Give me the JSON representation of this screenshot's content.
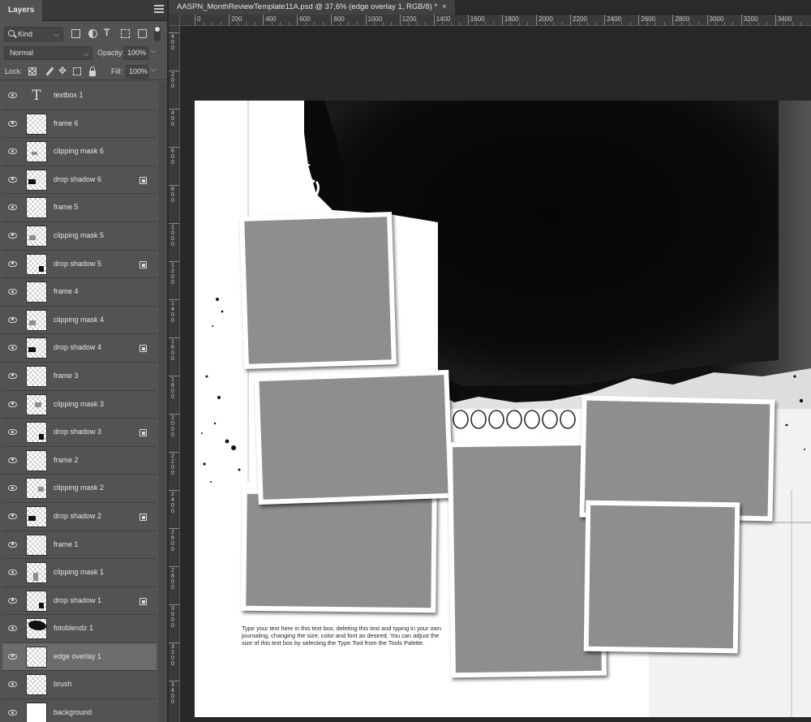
{
  "panel": {
    "title": "Layers",
    "filter_kind": "Kind",
    "blend_mode": "Normal",
    "opacity_label": "Opacity:",
    "opacity_value": "100%",
    "lock_label": "Lock:",
    "fill_label": "Fill:",
    "fill_value": "100%"
  },
  "document": {
    "tab_title": "AASPN_MonthReviewTemplate11A.psd @ 37,6% (edge overlay 1, RGB/8) *",
    "close_glyph": "×"
  },
  "ruler": {
    "h_labels": [
      "0",
      "200",
      "400",
      "600",
      "800",
      "1000",
      "1200",
      "1400",
      "1600",
      "1800",
      "2000",
      "2200",
      "2400",
      "2600",
      "2800",
      "3000",
      "3200",
      "3400"
    ],
    "v_labels": [
      "4\n0\n0",
      "2\n0\n0",
      "4\n0\n0",
      "6\n0\n0",
      "8\n0\n0",
      "1\n0\n0\n0",
      "1\n2\n0\n0",
      "1\n4\n0\n0",
      "1\n6\n0\n0",
      "1\n8\n0\n0",
      "2\n0\n0\n0",
      "2\n2\n0\n0",
      "2\n4\n0\n0",
      "2\n6\n0\n0",
      "2\n8\n0\n0",
      "3\n0\n0\n0",
      "3\n2\n0\n0",
      "3\n4\n0\n0"
    ]
  },
  "layers": [
    {
      "name": "textbox 1",
      "kind": "type",
      "smart": false
    },
    {
      "name": "frame 6",
      "kind": "frame",
      "smart": false
    },
    {
      "name": "clipping mask 6",
      "kind": "mask",
      "smart": false
    },
    {
      "name": "drop shadow 6",
      "kind": "shadow",
      "smart": true
    },
    {
      "name": "frame 5",
      "kind": "frame",
      "smart": false
    },
    {
      "name": "clipping mask 5",
      "kind": "mask",
      "smart": false
    },
    {
      "name": "drop shadow 5",
      "kind": "shadow",
      "smart": true
    },
    {
      "name": "frame 4",
      "kind": "frame",
      "smart": false
    },
    {
      "name": "clipping mask 4",
      "kind": "mask",
      "smart": false
    },
    {
      "name": "drop shadow 4",
      "kind": "shadow",
      "smart": true
    },
    {
      "name": "frame 3",
      "kind": "frame",
      "smart": false
    },
    {
      "name": "clipping mask 3",
      "kind": "mask",
      "smart": false
    },
    {
      "name": "drop shadow 3",
      "kind": "shadow",
      "smart": true
    },
    {
      "name": "frame 2",
      "kind": "frame",
      "smart": false
    },
    {
      "name": "clipping mask 2",
      "kind": "mask",
      "smart": false
    },
    {
      "name": "drop shadow 2",
      "kind": "shadow",
      "smart": true
    },
    {
      "name": "frame 1",
      "kind": "frame",
      "smart": false
    },
    {
      "name": "clipping mask 1",
      "kind": "mask",
      "smart": false
    },
    {
      "name": "drop shadow 1",
      "kind": "shadow",
      "smart": true
    },
    {
      "name": "fotoblendz 1",
      "kind": "blend",
      "smart": false
    },
    {
      "name": "edge overlay 1",
      "kind": "overlay",
      "smart": false,
      "selected": true
    },
    {
      "name": "brush",
      "kind": "brush",
      "smart": false
    },
    {
      "name": "background",
      "kind": "background",
      "smart": false
    }
  ],
  "canvas": {
    "journal_text": "Type your text here in this text box, deleting this text and typing in your own journaling, changing the size, color and font as desired.  You can adjust the size of this text box by selecting the Type Tool from the Tools Palette."
  },
  "colors": {
    "panel_bg": "#535353",
    "selected_row": "#6c6c6c",
    "photo_placeholder": "#8e8e8e",
    "pasteboard": "#282828"
  }
}
